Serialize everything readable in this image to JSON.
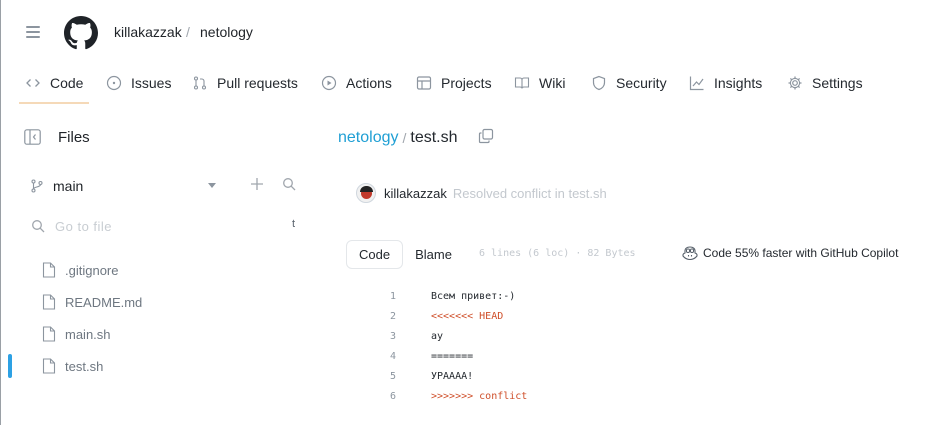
{
  "header": {
    "owner": "killakazzak",
    "separator": "/",
    "repo": "netology"
  },
  "tabs": [
    {
      "label": "Code",
      "icon": "code-icon",
      "active": true
    },
    {
      "label": "Issues",
      "icon": "issue-icon"
    },
    {
      "label": "Pull requests",
      "icon": "pull-request-icon"
    },
    {
      "label": "Actions",
      "icon": "play-icon"
    },
    {
      "label": "Projects",
      "icon": "table-icon"
    },
    {
      "label": "Wiki",
      "icon": "book-icon"
    },
    {
      "label": "Security",
      "icon": "shield-icon"
    },
    {
      "label": "Insights",
      "icon": "graph-icon"
    },
    {
      "label": "Settings",
      "icon": "gear-icon"
    }
  ],
  "files_panel": {
    "title": "Files",
    "branch": "main",
    "goto_placeholder": "Go to file",
    "goto_shortcut": "t",
    "files": [
      {
        "name": ".gitignore"
      },
      {
        "name": "README.md"
      },
      {
        "name": "main.sh"
      },
      {
        "name": "test.sh",
        "selected": true
      }
    ]
  },
  "main": {
    "path_repo": "netology",
    "path_sep": "/",
    "path_file": "test.sh",
    "commit_author": "killakazzak",
    "commit_message": "Resolved conflict in test.sh",
    "code_tab": "Code",
    "blame_tab": "Blame",
    "meta": "6 lines (6 loc) · 82 Bytes",
    "copilot_text": "Code 55% faster with GitHub Copilot",
    "lines": [
      {
        "num": "1",
        "text": "Всем привет:-)"
      },
      {
        "num": "2",
        "text": "<<<<<<< HEAD"
      },
      {
        "num": "3",
        "text": "ау"
      },
      {
        "num": "4",
        "text": "======="
      },
      {
        "num": "5",
        "text": "УРАААА!"
      },
      {
        "num": "6",
        "text": ">>>>>>> conflict"
      }
    ]
  },
  "colors": {
    "accent_link": "#1f9fd4",
    "active_indicator": "#2da1e4",
    "tab_underline": "#f5d9b8",
    "conflict_marker": "#cf4f2a"
  }
}
